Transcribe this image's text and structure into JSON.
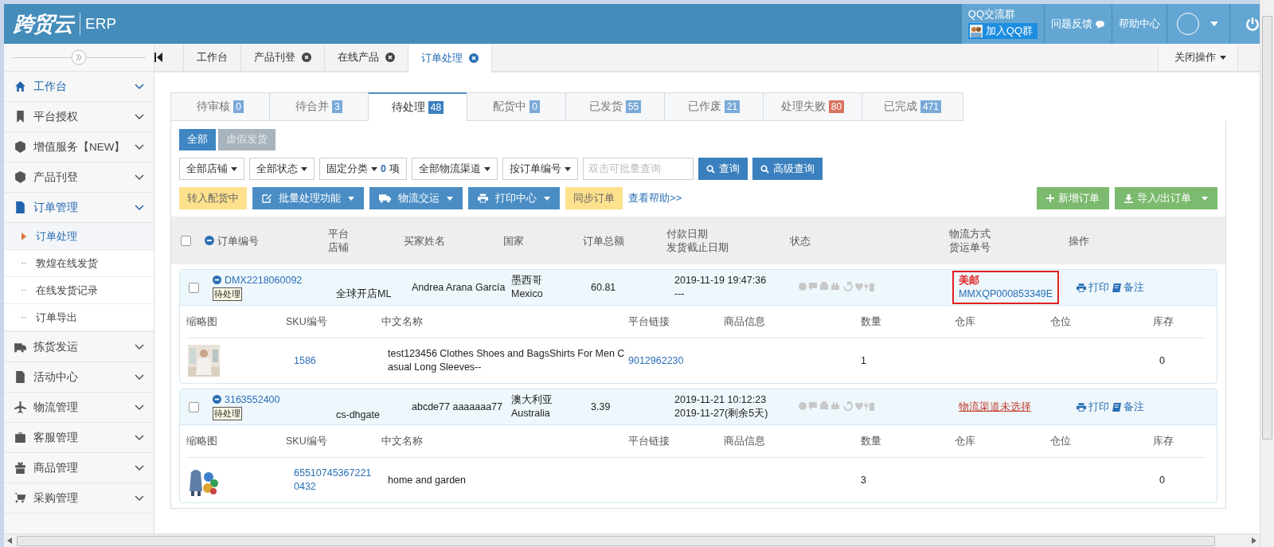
{
  "header": {
    "logo": "跨贸云",
    "product": "ERP",
    "qq_group": {
      "title": "QQ交流群",
      "button": "加入QQ群"
    },
    "links": [
      {
        "label": "问题反馈",
        "icon": true
      },
      {
        "label": "帮助中心",
        "icon": false
      }
    ]
  },
  "page_tabs": [
    {
      "label": "工作台",
      "closable": false,
      "selected": false
    },
    {
      "label": "产品刊登",
      "closable": true,
      "selected": false
    },
    {
      "label": "在线产品",
      "closable": true,
      "selected": false
    },
    {
      "label": "订单处理",
      "closable": true,
      "selected": true
    }
  ],
  "close_menu": "关闭操作",
  "sidebar": {
    "items": [
      {
        "label": "工作台",
        "active": true
      },
      {
        "label": "平台授权",
        "active": false
      },
      {
        "label": "增值服务【NEW】",
        "active": false
      },
      {
        "label": "产品刊登",
        "active": false
      },
      {
        "label": "订单管理",
        "active": true,
        "children": [
          {
            "label": "订单处理",
            "selected": true
          },
          {
            "label": "敦煌在线发货",
            "selected": false
          },
          {
            "label": "在线发货记录",
            "selected": false
          },
          {
            "label": "订单导出",
            "selected": false
          }
        ]
      },
      {
        "label": "拣货发运",
        "active": false
      },
      {
        "label": "活动中心",
        "active": false
      },
      {
        "label": "物流管理",
        "active": false
      },
      {
        "label": "客服管理",
        "active": false
      },
      {
        "label": "商品管理",
        "active": false
      },
      {
        "label": "采购管理",
        "active": false
      }
    ]
  },
  "status_tabs": [
    {
      "label": "待审核",
      "count": "0",
      "selected": false,
      "color": "#7aa9d8"
    },
    {
      "label": "待合并",
      "count": "3",
      "selected": false,
      "color": "#7aa9d8"
    },
    {
      "label": "待处理",
      "count": "48",
      "selected": true,
      "color": "#3c7fc0"
    },
    {
      "label": "配货中",
      "count": "0",
      "selected": false,
      "color": "#7aa9d8"
    },
    {
      "label": "已发货",
      "count": "55",
      "selected": false,
      "color": "#7aa9d8"
    },
    {
      "label": "已作废",
      "count": "21",
      "selected": false,
      "color": "#7aa9d8"
    },
    {
      "label": "处理失败",
      "count": "80",
      "selected": false,
      "color": "#d9725f"
    },
    {
      "label": "已完成",
      "count": "471",
      "selected": false,
      "color": "#7aa9d8"
    }
  ],
  "type_buttons": [
    {
      "label": "全部",
      "selected": true
    },
    {
      "label": "虚假发货",
      "selected": false
    }
  ],
  "filters": [
    {
      "kind": "dropdown",
      "label": "全部店铺"
    },
    {
      "kind": "dropdown",
      "label": "全部状态"
    },
    {
      "kind": "category",
      "label": "固定分类",
      "count": "0",
      "unit": "项"
    },
    {
      "kind": "dropdown",
      "label": "全部物流渠道"
    },
    {
      "kind": "dropdown",
      "label": "按订单编号"
    }
  ],
  "search": {
    "placeholder": "双击可批量查询",
    "buttons": [
      "查询",
      "高级查询"
    ]
  },
  "actions": [
    {
      "kind": "soft",
      "label": "转入配货中"
    },
    {
      "kind": "menu",
      "label": "批量处理功能"
    },
    {
      "kind": "menu",
      "label": "物流交运"
    },
    {
      "kind": "menu",
      "label": "打印中心"
    },
    {
      "kind": "soft",
      "label": "同步订单"
    },
    {
      "kind": "link",
      "label": "查看帮助>>"
    }
  ],
  "right_actions": [
    {
      "label": "新增订单",
      "menu": false
    },
    {
      "label": "导入/出订单",
      "menu": true
    }
  ],
  "columns": [
    {
      "lines": [
        "订单编号"
      ]
    },
    {
      "lines": [
        "平台",
        "店铺"
      ]
    },
    {
      "lines": [
        "买家姓名"
      ]
    },
    {
      "lines": [
        "国家"
      ]
    },
    {
      "lines": [
        "订单总额"
      ]
    },
    {
      "lines": [
        "付款日期",
        "发货截止日期"
      ]
    },
    {
      "lines": [
        "状态"
      ]
    },
    {
      "lines": [
        "物流方式",
        "货运单号"
      ]
    },
    {
      "lines": [
        "操作"
      ]
    }
  ],
  "orders": [
    {
      "checked": false,
      "order_no": "DMX2218060092",
      "tag": "待处理",
      "store": "全球开店ML",
      "buyer": "Andrea Arana García",
      "country": [
        "墨西哥",
        "Mexico"
      ],
      "total": "60.81",
      "dates": [
        "2019-11-19 19:47:36",
        "---"
      ],
      "shipping": {
        "kind": "assigned",
        "carrier": "美邮",
        "tracking": "MMXQP000853349E",
        "highlighted": true
      },
      "ops": [
        "打印",
        "备注"
      ],
      "item_columns": [
        "缩略图",
        "SKU编号",
        "中文名称",
        "平台链接",
        "商品信息",
        "数量",
        "仓库",
        "仓位",
        "库存"
      ],
      "items": [
        {
          "sku": "1586",
          "name": "test123456 Clothes Shoes and BagsShirts For Men Casual Long Sleeves--",
          "link": "9012962230",
          "quantity": "1",
          "stock": "0"
        }
      ]
    },
    {
      "checked": false,
      "order_no": "3163552400",
      "tag": "待处理",
      "store": "cs-dhgate",
      "buyer": "abcde77 aaaaaaa77",
      "country": [
        "澳大利亚",
        "Australia"
      ],
      "total": "3.39",
      "dates": [
        "2019-11-21 10:12:23",
        "2019-11-27(剩余5天)"
      ],
      "shipping": {
        "kind": "unassigned",
        "label": "物流渠道未选择",
        "highlighted": false
      },
      "ops": [
        "打印",
        "备注"
      ],
      "item_columns": [
        "缩略图",
        "SKU编号",
        "中文名称",
        "平台链接",
        "商品信息",
        "数量",
        "仓库",
        "仓位",
        "库存"
      ],
      "items": [
        {
          "sku": "655107453672210432",
          "name": "home and garden",
          "quantity": "3",
          "stock": "0"
        }
      ]
    }
  ],
  "select_all": {
    "checked": false
  }
}
